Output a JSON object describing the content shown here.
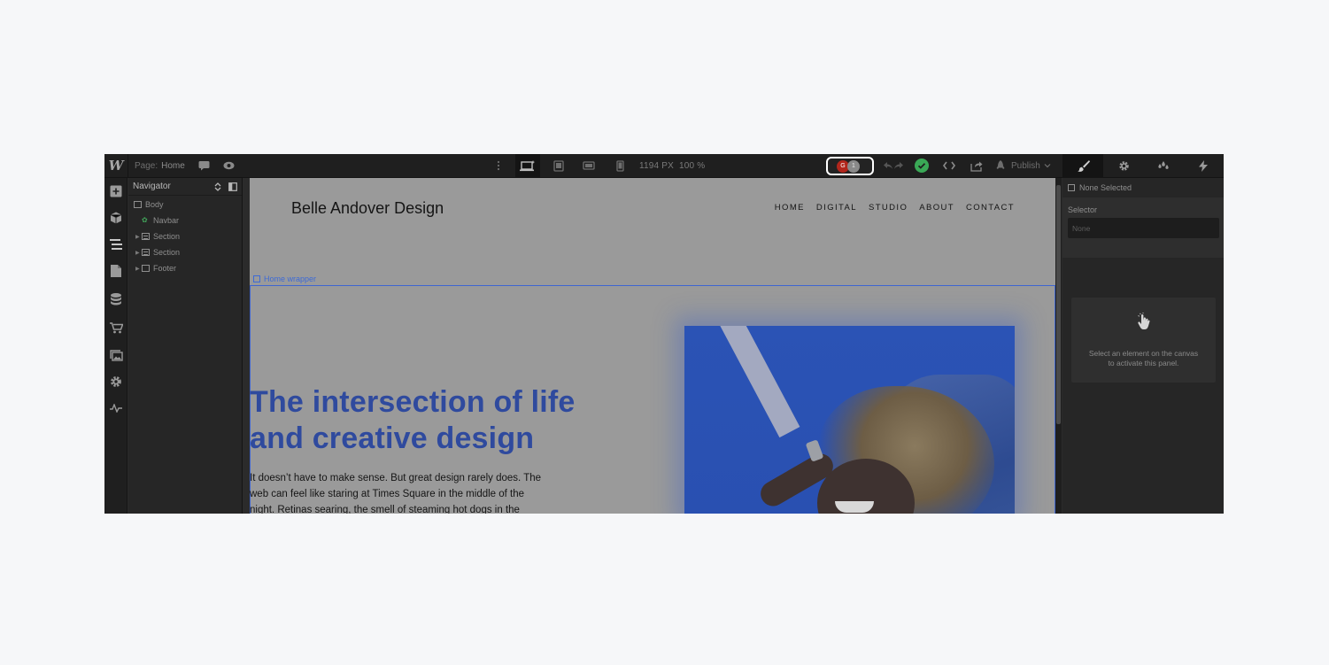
{
  "topbar": {
    "logo": "W",
    "page_label": "Page:",
    "page_value": "Home",
    "width_readout": "1194 PX",
    "zoom_readout": "100 %",
    "collaborator_initial": "G",
    "collaborator_count": "1",
    "publish_label": "Publish"
  },
  "navigator": {
    "title": "Navigator",
    "items": [
      {
        "label": "Body"
      },
      {
        "label": "Navbar"
      },
      {
        "label": "Section"
      },
      {
        "label": "Section"
      },
      {
        "label": "Footer"
      }
    ]
  },
  "canvas": {
    "brand": "Belle Andover Design",
    "nav_links": [
      "HOME",
      "DIGITAL",
      "STUDIO",
      "ABOUT",
      "CONTACT"
    ],
    "selected_label": "Home wrapper",
    "hero_title_lines": [
      "The intersection of life",
      "and creative design"
    ],
    "hero_body_lines": [
      "It doesn’t have to make sense. But great design rarely does. The",
      "web can feel like staring at Times Square in the middle of the",
      "night. Retinas searing, the smell of steaming hot dogs in the"
    ]
  },
  "right_panel": {
    "selection_status": "None Selected",
    "selector_label": "Selector",
    "selector_placeholder": "None",
    "empty_message_lines": [
      "Select an element on the canvas",
      "to activate this panel."
    ]
  },
  "colors": {
    "accent_blue": "#3d6ad6",
    "hero_title": "#2f4a9e",
    "collab_avatar": "#b2261c",
    "status_ok": "#3aa856"
  }
}
